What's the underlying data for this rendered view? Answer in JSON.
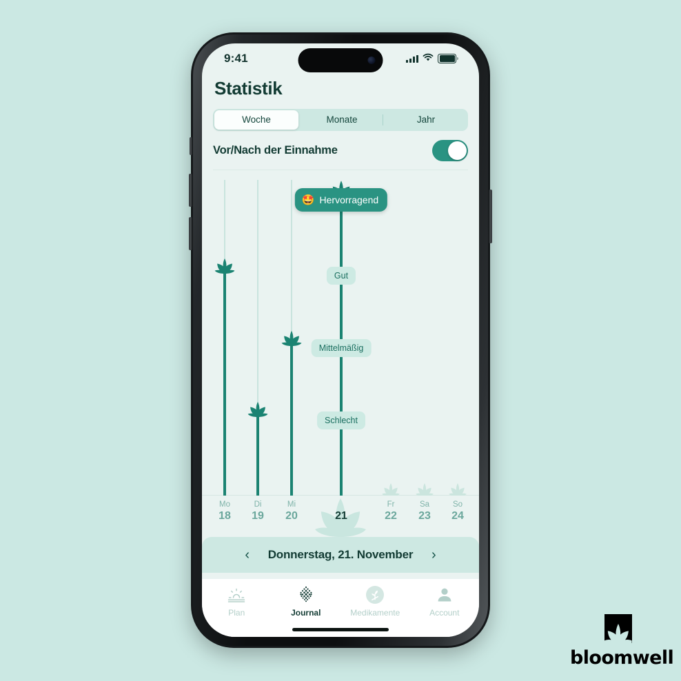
{
  "status_bar": {
    "time": "9:41",
    "signal_icon": "cellular-bars-icon",
    "wifi_icon": "wifi-icon",
    "battery_icon": "battery-full-icon"
  },
  "header": {
    "title": "Statistik"
  },
  "segmented": {
    "options": [
      "Woche",
      "Monate",
      "Jahr"
    ],
    "selected": "Woche"
  },
  "toggle_row": {
    "label": "Vor/Nach der Einnahme",
    "state": "on"
  },
  "chart_data": {
    "type": "bar",
    "title": "Statistik",
    "xlabel": "",
    "ylabel": "",
    "categories": [
      "Mo 18",
      "Di 19",
      "Mi 20",
      "Do 21",
      "Fr 22",
      "Sa 23",
      "So 24"
    ],
    "weekdays": [
      "Mo",
      "Di",
      "Mi",
      "Do",
      "Fr",
      "Sa",
      "So"
    ],
    "daynumbers": [
      "18",
      "19",
      "20",
      "21",
      "22",
      "23",
      "24"
    ],
    "rating_scale": [
      "Schlecht",
      "Mittelmäßig",
      "Gut",
      "Hervorragend"
    ],
    "values": [
      3.0,
      1.1,
      2.2,
      4.0,
      null,
      null,
      null
    ],
    "value_labels": [
      "Gut",
      "Schlecht",
      "Mittelmäßig",
      "Hervorragend",
      "",
      "",
      ""
    ],
    "selected_category": "Do 21",
    "grid": false,
    "legend": "none",
    "axis_labels": [
      {
        "label": "Hervorragend",
        "emoji": "🤩",
        "highlighted": true
      },
      {
        "label": "Gut",
        "emoji": "",
        "highlighted": false
      },
      {
        "label": "Mittelmäßig",
        "emoji": "",
        "highlighted": false
      },
      {
        "label": "Schlecht",
        "emoji": "",
        "highlighted": false
      }
    ]
  },
  "date_bar": {
    "prev_icon": "chevron-left-icon",
    "date": "Donnerstag, 21. November",
    "next_icon": "chevron-right-icon"
  },
  "tab_bar": {
    "tabs": [
      {
        "label": "Plan",
        "icon": "sunrise-icon",
        "active": false
      },
      {
        "label": "Journal",
        "icon": "dotted-leaf-icon",
        "active": true
      },
      {
        "label": "Medikamente",
        "icon": "sprout-circle-icon",
        "active": false
      },
      {
        "label": "Account",
        "icon": "person-icon",
        "active": false
      }
    ]
  },
  "brand": {
    "name": "bloomwell",
    "mark": "leaf-square-logo"
  },
  "colors": {
    "page_background": "#cbe8e3",
    "screen_background": "#eaf3f1",
    "accent_teal": "#2a9382",
    "dark_green": "#123b33",
    "stem_green": "#1b8372",
    "pill_light": "#cdeae3",
    "muted_text": "#7fb3a9"
  }
}
